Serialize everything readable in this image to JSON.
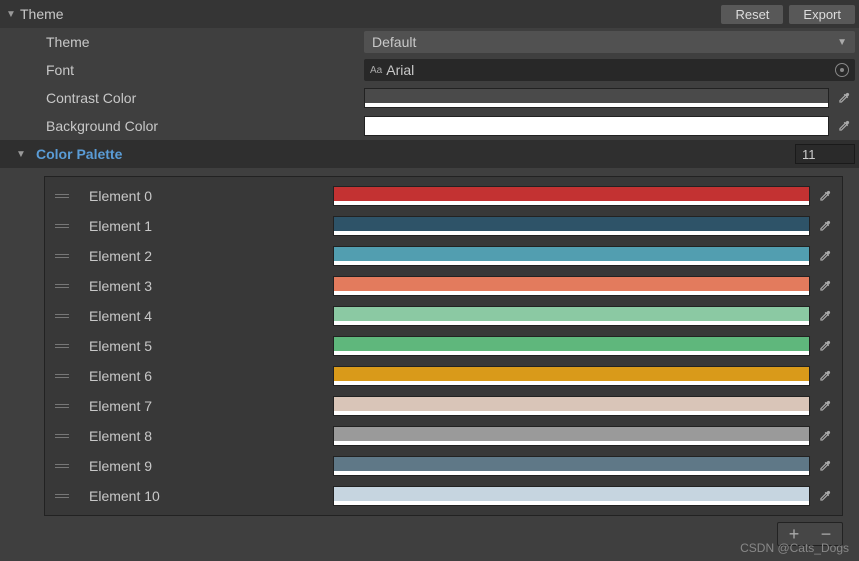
{
  "header": {
    "title": "Theme",
    "reset_label": "Reset",
    "export_label": "Export"
  },
  "properties": {
    "theme_label": "Theme",
    "theme_value": "Default",
    "font_label": "Font",
    "font_value": "Arial",
    "contrast_label": "Contrast Color",
    "contrast_color": "#4a4a4a",
    "background_label": "Background Color",
    "background_color": "#ffffff"
  },
  "palette": {
    "title": "Color Palette",
    "count": "11",
    "elements": [
      {
        "label": "Element 0",
        "color": "#c33232"
      },
      {
        "label": "Element 1",
        "color": "#2e5368"
      },
      {
        "label": "Element 2",
        "color": "#529eb0"
      },
      {
        "label": "Element 3",
        "color": "#e37b5d"
      },
      {
        "label": "Element 4",
        "color": "#8bc9a3"
      },
      {
        "label": "Element 5",
        "color": "#5fb77c"
      },
      {
        "label": "Element 6",
        "color": "#d99a1a"
      },
      {
        "label": "Element 7",
        "color": "#d9c5b8"
      },
      {
        "label": "Element 8",
        "color": "#9a9a9a"
      },
      {
        "label": "Element 9",
        "color": "#5f7887"
      },
      {
        "label": "Element 10",
        "color": "#c6d5e0"
      }
    ]
  },
  "watermark": "CSDN @Cats_Dogs"
}
